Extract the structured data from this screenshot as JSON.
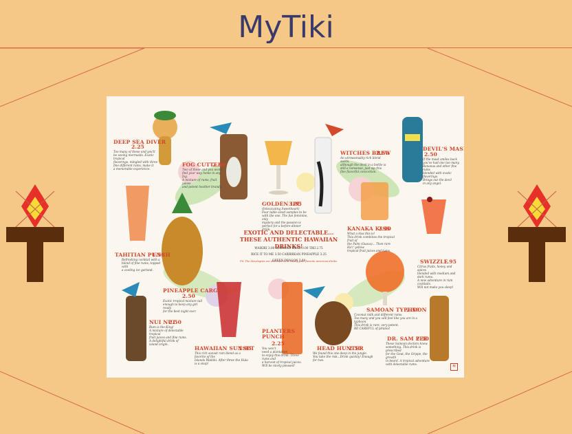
{
  "header": {
    "title": "MyTiki"
  },
  "icons": {
    "torch_left": "tiki-torch-icon",
    "torch_right": "tiki-torch-icon"
  },
  "colors": {
    "background": "#f5c888",
    "lines": "#d86a4a",
    "title": "#3a3a6a",
    "menu_red": "#d2452a"
  },
  "menu": {
    "headline": "EXOTIC AND DELECTABLE...\nTHESE AUTHENTIC HAWAIIAN DRINKS!",
    "prices": "WAIKIKI  3.00    DIAMOND HEAD  3.00    TIKI  2.75\nRICE IT TO ME  3.50    CARIBBEAN PINEAPPLE  3.25\nGREEN DRAGON  3.00",
    "footnote": "P.S. The Mixologists are also experts in mixing your favorite American drinks.",
    "stamp": "M",
    "drinks": [
      {
        "key": "deep_sea_diver",
        "name": "DEEP SEA DIVER",
        "price": "2.25",
        "desc": "Too many of these and you'll\nbe seeing mermaids. Exotic tropical\nflavorings, mingled with three\nfine different rums, make it\na memorable experience."
      },
      {
        "key": "fog_cutter",
        "name": "FOG CUTTER",
        "price": "2.50",
        "desc": "Two of these and you won't\nfind your way home in any fog.\nA mixture of rums, fruit juices\nand potent heather brandy."
      },
      {
        "key": "golden_ipu",
        "name": "GOLDEN IPU",
        "price": "3.35",
        "desc": "(Intoxicating Sweetheart)\nFour table-sized samples to be\nwith the one. The fun feminine, only\nmystery and the passion is\nperfect for a before-dinner drink."
      },
      {
        "key": "witches_brew",
        "name": "WITCHES BREW",
        "price": "2.50",
        "desc": "An unreasonably rich blend swirls\nalthough the devil in a bottle is\nstill a nonsense, just sip this\nfine flavorful concoction."
      },
      {
        "key": "devils_mask",
        "name": "DEVIL'S MASK",
        "price": "2.50",
        "desc": "If the mask smiles back\nyou've had one too many.\nBananas and other fine rums\nblended with exotic flavorings.\nBrings out the devil\nin any angel."
      },
      {
        "key": "tahitian_punch",
        "name": "TAHITIAN PUNCH",
        "price": "1.55",
        "desc": "Refreshing cocktail with a\nblend of fine rums, topped with\na cooling ice garland."
      },
      {
        "key": "kanaka_kiss",
        "name": "KANAKA KISS",
        "price": "2.50",
        "desc": "What a kiss this is!\nThis drink combines the tropical fruit of\nthe Palm (Guava)... Then rare Ha'i' yellow\ntropical fruit juices and rums."
      },
      {
        "key": "swizzle",
        "name": "SWIZZLE",
        "price": "1.95",
        "desc": "Citrus fruits, honey and spices\nblended with medium and dark rums.\nA new adventure in rum cocktails.\nWill not make you sleep!"
      },
      {
        "key": "pineapple_cargo",
        "name": "PINEAPPLE CARGO CUP",
        "price": "2.50",
        "desc": "Exotic tropical mixture tall\nenough to keep any girl ready\nfor the best night ever."
      },
      {
        "key": "nui_nui",
        "name": "NUI NUI",
        "price": "2.50",
        "desc": "Rum is the King!\nA mixture of delectable tropical\nfruit juices and fine rums.\nA delightful drink of\nisland origin."
      },
      {
        "key": "hawaiian_sunset",
        "name": "HAWAIIAN SUNSET",
        "price": "1.95",
        "desc": "This rich sunset rum blend as a favorite of the\nIslands Waikiki. After three the Hula is a snap!"
      },
      {
        "key": "planters_punch",
        "name": "PLANTERS PUNCH",
        "price": "2.25",
        "desc": "You won't\nneed a plantation\nto enjoy this drink. Three rums and\na harvest of tropical juices.\nWill be nicely pleased!"
      },
      {
        "key": "head_hunter",
        "name": "HEAD HUNTER",
        "price": "2.50",
        "desc": "We found this one deep in the jungle.\nYou take the risk...Drink quickly! Enough for two."
      },
      {
        "key": "samoan_typhoon",
        "name": "SAMOAN TYPHOON",
        "price": "2.50",
        "desc": "Coconut milk and different rums.\nToo many and you will feel like you are in a typhoon.\nThis drink is rare, very potent.\nBE CAREFUL of pirates!"
      },
      {
        "key": "dr_sam_fee",
        "name": "DR. SAM FEE",
        "price": "2.50",
        "desc": "These Samoan doctors know\nsomething. This drink is prescribed\nfor the Gout, the Grippe, the growth\nin beard. A tropical adventure\nwith delectable rums."
      }
    ]
  }
}
